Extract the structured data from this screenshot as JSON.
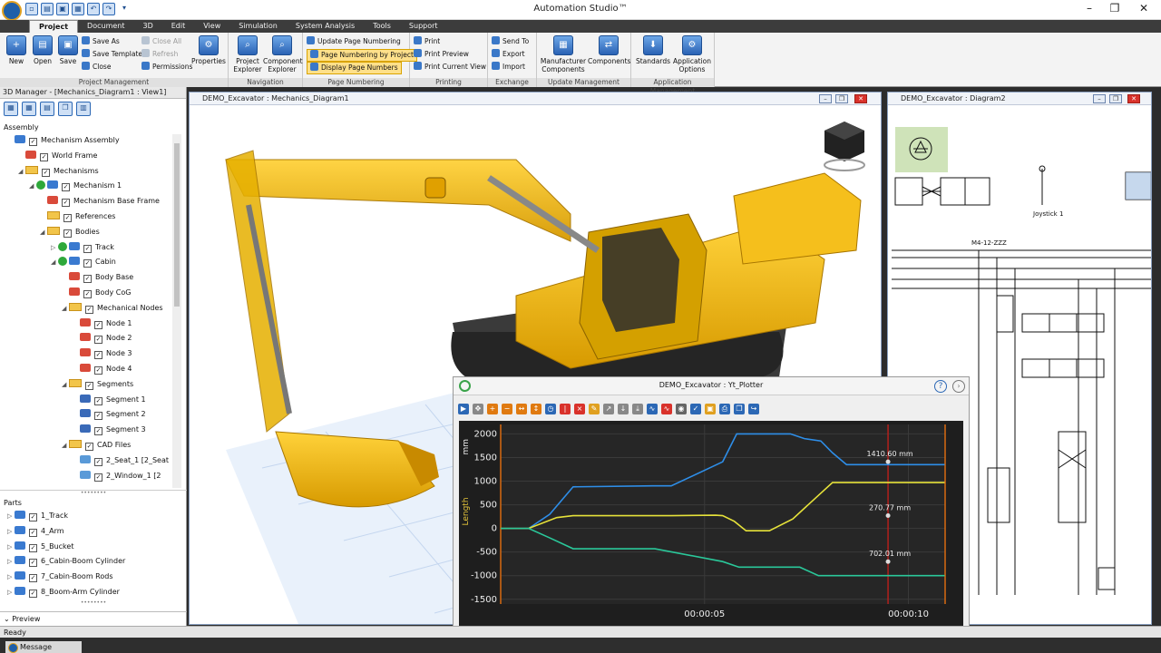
{
  "app": {
    "title": "Automation Studio™"
  },
  "menu": [
    "Project",
    "Document",
    "3D",
    "Edit",
    "View",
    "Simulation",
    "System Analysis",
    "Tools",
    "Support"
  ],
  "ribbon": {
    "project_management": {
      "label": "Project Management",
      "new": "New",
      "open": "Open",
      "save": "Save",
      "save_as": "Save As",
      "save_template": "Save Template",
      "close": "Close",
      "close_all": "Close All",
      "refresh": "Refresh",
      "permissions": "Permissions",
      "properties": "Properties"
    },
    "navigation": {
      "label": "Navigation",
      "project_explorer": "Project Explorer",
      "component_explorer": "Component Explorer"
    },
    "page_numbering": {
      "label": "Page Numbering",
      "update": "Update Page Numbering",
      "by_project": "Page Numbering by Project",
      "display": "Display Page Numbers"
    },
    "printing": {
      "label": "Printing",
      "print": "Print",
      "print_preview": "Print Preview",
      "print_current_view": "Print Current View"
    },
    "exchange": {
      "label": "Exchange",
      "send_to": "Send To",
      "export": "Export",
      "import": "Import"
    },
    "update_management": {
      "label": "Update Management",
      "manufacturer_components": "Manufacturer Components",
      "components": "Components"
    },
    "application_management": {
      "label": "Application Management",
      "standards": "Standards",
      "application_options": "Application Options"
    }
  },
  "manager": {
    "title": "3D Manager - [Mechanics_Diagram1 : View1]",
    "assembly_label": "Assembly",
    "tree": [
      "Mechanism Assembly",
      "World Frame",
      "Mechanisms",
      "Mechanism 1",
      "Mechanism Base Frame",
      "References",
      "Bodies",
      "Track",
      "Cabin",
      "Body Base",
      "Body CoG",
      "Mechanical Nodes",
      "Node 1",
      "Node 2",
      "Node 3",
      "Node 4",
      "Segments",
      "Segment 1",
      "Segment 2",
      "Segment 3",
      "CAD Files",
      "2_Seat_1  [2_Seat",
      "2_Window_1  [2"
    ],
    "parts_label": "Parts",
    "parts": [
      "1_Track",
      "4_Arm",
      "5_Bucket",
      "6_Cabin-Boom Cylinder",
      "7_Cabin-Boom Rods",
      "8_Boom-Arm Cylinder"
    ],
    "preview_label": "Preview"
  },
  "doc_mech": {
    "title": "DEMO_Excavator : Mechanics_Diagram1"
  },
  "doc_diag": {
    "title": "DEMO_Excavator : Diagram2",
    "joystick": "Joystick 1",
    "line_label": "M4-12-ZZZ"
  },
  "plotter": {
    "title": "DEMO_Excavator : Yt_Plotter"
  },
  "chart_data": {
    "type": "line",
    "unit": "mm",
    "ylabel": "Length",
    "ylim": [
      -1600,
      2200
    ],
    "yticks": [
      2000,
      1500,
      1000,
      500,
      0,
      -500,
      -1000,
      -1500
    ],
    "xlim": [
      0,
      10.9
    ],
    "xticks": [
      {
        "t": 5,
        "label": "00:00:05"
      },
      {
        "t": 10,
        "label": "00:00:10"
      }
    ],
    "cursor_t": 9.5,
    "series": [
      {
        "color": "#2e8ee8",
        "points": [
          [
            0,
            0
          ],
          [
            1.2,
            0
          ],
          [
            2.1,
            300
          ],
          [
            3.1,
            880
          ],
          [
            6.5,
            900
          ],
          [
            7.3,
            900
          ],
          [
            9.5,
            1410
          ],
          [
            10.1,
            2000
          ],
          [
            12.4,
            2000
          ],
          [
            13,
            1900
          ],
          [
            13.7,
            1850
          ],
          [
            14.2,
            1600
          ],
          [
            14.8,
            1350
          ],
          [
            19,
            1350
          ]
        ]
      },
      {
        "color": "#e6e23a",
        "points": [
          [
            0,
            0
          ],
          [
            1.2,
            0
          ],
          [
            2.4,
            230
          ],
          [
            3.1,
            270
          ],
          [
            7.3,
            270
          ],
          [
            9.2,
            280
          ],
          [
            9.5,
            270.77
          ],
          [
            10,
            150
          ],
          [
            10.5,
            -50
          ],
          [
            11.5,
            -50
          ],
          [
            12.5,
            200
          ],
          [
            13.6,
            700
          ],
          [
            14.2,
            970
          ],
          [
            19,
            970
          ]
        ]
      },
      {
        "color": "#2ac89a",
        "points": [
          [
            0,
            0
          ],
          [
            1.2,
            0
          ],
          [
            2.1,
            -200
          ],
          [
            3.1,
            -430
          ],
          [
            6.6,
            -430
          ],
          [
            9.5,
            -702.01
          ],
          [
            10.2,
            -820
          ],
          [
            12.8,
            -820
          ],
          [
            13.6,
            -1000
          ],
          [
            19,
            -1000
          ]
        ]
      }
    ],
    "annotations": [
      {
        "series": 0,
        "t": 9.5,
        "value": 1410.6,
        "label": "1410.60 mm"
      },
      {
        "series": 1,
        "t": 9.5,
        "value": 270.77,
        "label": "270.77 mm"
      },
      {
        "series": 2,
        "t": 9.5,
        "value": -702.01,
        "label": "702.01 mm"
      }
    ]
  },
  "status": {
    "text": "Ready"
  },
  "message_tab": "Message Explorer",
  "colors": {
    "accent": "#2c68b5",
    "excavator": "#f5b400",
    "plot_bg": "#262626"
  }
}
